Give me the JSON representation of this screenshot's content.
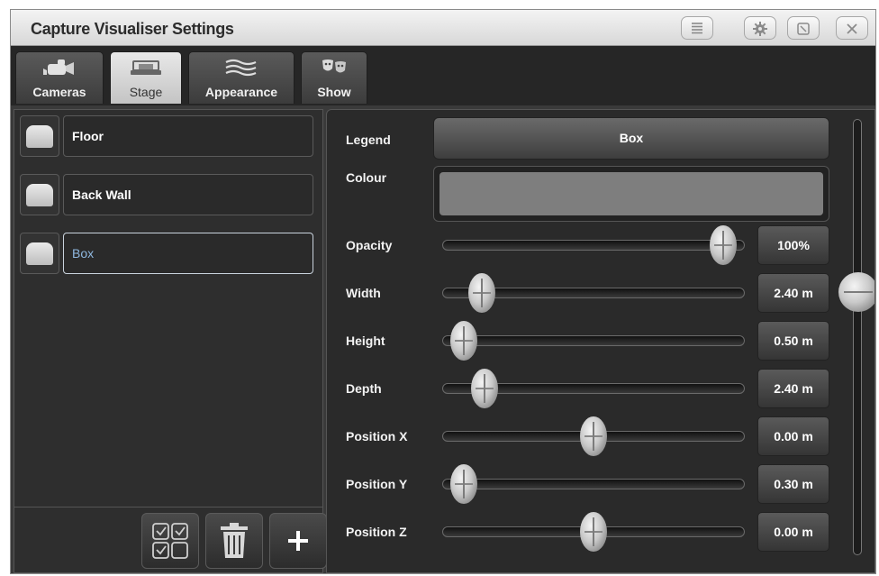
{
  "window": {
    "title": "Capture Visualiser Settings",
    "title_buttons": [
      "menu-icon",
      "gear-icon",
      "resize-icon",
      "close-icon"
    ]
  },
  "tabs": [
    {
      "label": "Cameras",
      "icon": "camera-icon",
      "selected": false
    },
    {
      "label": "Stage",
      "icon": "stage-icon",
      "selected": true
    },
    {
      "label": "Appearance",
      "icon": "waves-icon",
      "selected": false
    },
    {
      "label": "Show",
      "icon": "masks-icon",
      "selected": false
    }
  ],
  "stage_items": [
    {
      "label": "Floor",
      "icon": "box-icon",
      "selected": false
    },
    {
      "label": "Back Wall",
      "icon": "box-icon",
      "selected": false
    },
    {
      "label": "Box",
      "icon": "box-icon",
      "selected": true
    }
  ],
  "footer_buttons": [
    "select-all-icon",
    "trash-icon",
    "plus-icon"
  ],
  "properties": {
    "legend": {
      "label": "Legend",
      "value": "Box"
    },
    "colour": {
      "label": "Colour",
      "value": "#7e7e7e"
    },
    "sliders": [
      {
        "label": "Opacity",
        "value": "100%",
        "fraction": 0.93
      },
      {
        "label": "Width",
        "value": "2.40 m",
        "fraction": 0.13
      },
      {
        "label": "Height",
        "value": "0.50 m",
        "fraction": 0.07
      },
      {
        "label": "Depth",
        "value": "2.40 m",
        "fraction": 0.14
      },
      {
        "label": "Position X",
        "value": "0.00 m",
        "fraction": 0.5
      },
      {
        "label": "Position Y",
        "value": "0.30 m",
        "fraction": 0.07
      },
      {
        "label": "Position Z",
        "value": "0.00 m",
        "fraction": 0.5
      }
    ]
  },
  "scroll": {
    "fraction": 0.38
  }
}
